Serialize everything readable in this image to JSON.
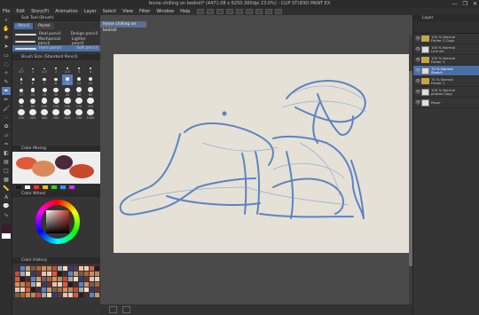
{
  "window": {
    "title": "fenne chilling on bedroll* (4471.08 x 6250.300dpi 23.0%) - CLIP STUDIO PAINT EX",
    "controls": [
      "—",
      "❐",
      "✕"
    ]
  },
  "menu": [
    "File",
    "Edit",
    "Story(P)",
    "Animation",
    "Layer",
    "Select",
    "View",
    "Filter",
    "Window",
    "Help"
  ],
  "subtool": {
    "header": "Sub Tool (Brush)",
    "tabs": [
      "Pencil",
      "Pastel"
    ],
    "brushes": [
      {
        "label": "Real pencil",
        "extra": "Design pencil"
      },
      {
        "label": "Mechanical pencil",
        "extra": "Lighter pencil"
      },
      {
        "label": "Hard pencil",
        "extra": "Soft pencil",
        "selected": true
      }
    ],
    "size_header": "Brush Size (Standard Pencil)",
    "sizes": [
      "0.7",
      "1",
      "1.5",
      "2",
      "2.5",
      "3",
      "4",
      "5",
      "6",
      "7",
      "8",
      "10",
      "12",
      "15",
      "17",
      "20",
      "25",
      "30",
      "40",
      "50",
      "60",
      "70",
      "80",
      "100",
      "120",
      "150",
      "170",
      "200",
      "250",
      "300",
      "400",
      "500",
      "600",
      "700",
      "1000"
    ],
    "selected_size": "10"
  },
  "color_mixing_header": "Color Mixing",
  "color_wheel_header": "Color Wheel",
  "color_sets_header": "Color History",
  "document_tab": "fenne chilling on bedroll",
  "layers": {
    "header": "Layer",
    "items": [
      {
        "name": "100 % Normal\nFolder 2 Copy",
        "type": "folder"
      },
      {
        "name": "100 % Normal\nLine art",
        "type": "raster"
      },
      {
        "name": "100 % Normal\nFolder 3",
        "type": "folder"
      },
      {
        "name": "74 % Normal\nSketch",
        "type": "raster",
        "selected": true
      },
      {
        "name": "74 % Normal\nFolder 1",
        "type": "folder"
      },
      {
        "name": "100 % Normal\nphotos Copy",
        "type": "raster"
      },
      {
        "name": "Paper",
        "type": "paper"
      }
    ]
  },
  "colors": {
    "accent": "#4b6fa5",
    "sketch_line": "#5b84c4",
    "canvas": "#e6e1d6"
  }
}
